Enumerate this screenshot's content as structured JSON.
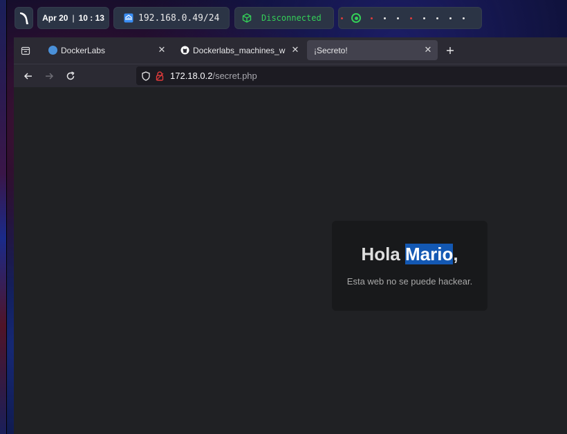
{
  "topbar": {
    "date": "Apr 20",
    "time": "10 : 13",
    "ip": "192.168.0.49/24",
    "vpn_status": "Disconnected",
    "accent": "#34d058"
  },
  "browser": {
    "tabs": [
      {
        "label": "DockerLabs",
        "icon": "dockerlabs-icon"
      },
      {
        "label": "Dockerlabs_machines_w",
        "icon": "github-icon"
      },
      {
        "label": "¡Secreto!",
        "active": true
      }
    ],
    "url": {
      "host": "172.18.0.2",
      "path": "/secret.php"
    }
  },
  "page": {
    "greeting": "Hola ",
    "name": "Mario",
    "comma": ",",
    "message": "Esta web no se puede hackear.",
    "selection_color": "#1358b3"
  }
}
